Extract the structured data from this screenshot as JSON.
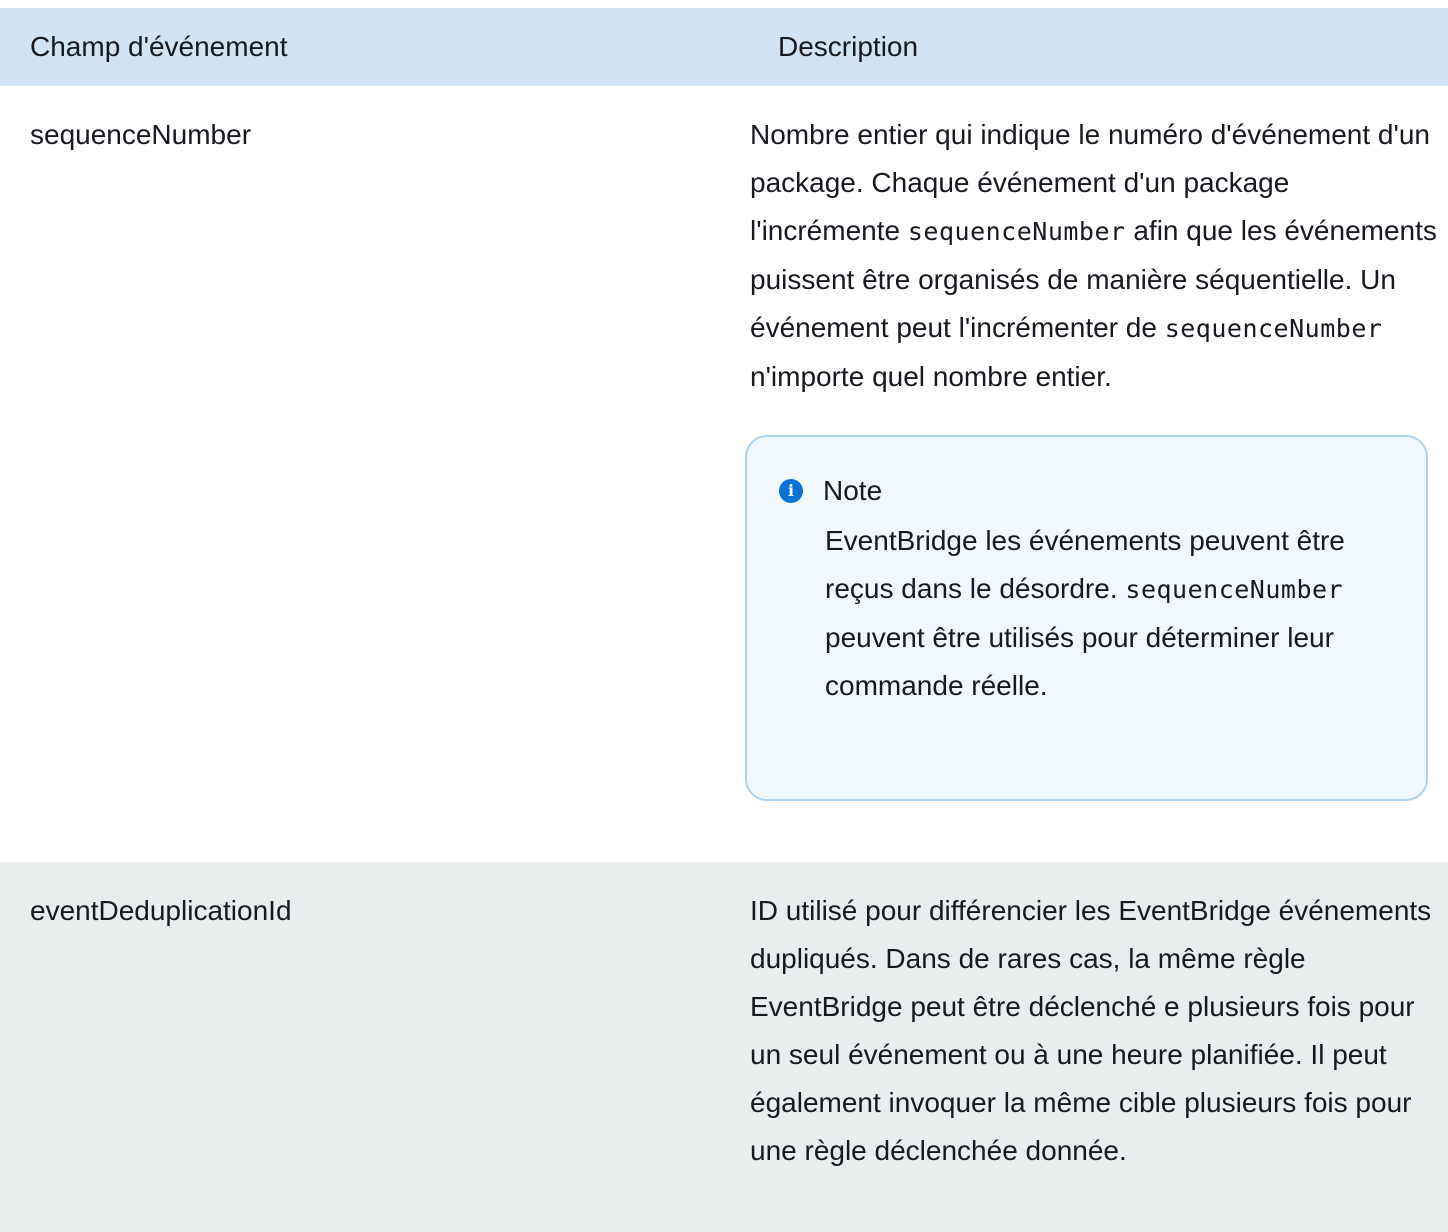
{
  "table": {
    "headers": [
      "Champ d'événement",
      "Description"
    ],
    "rows": [
      {
        "field": "sequenceNumber",
        "description_parts": [
          "Nombre entier qui indique le numéro d'événement d'un package. Chaque événement d'un package l'incrémente ",
          "sequenceNumber",
          " afin que les événements puissent être organisés de manière séquentielle. Un événement peut l'incrémenter de ",
          "sequenceNumber",
          " n'importe quel nombre entier."
        ],
        "note": {
          "title": "Note",
          "icon": "info-icon",
          "body_parts": [
            "EventBridge les événements peuvent être reçus dans le désordre. ",
            "sequenceNumber",
            " peuvent être utilisés pour déterminer leur commande réelle."
          ]
        }
      },
      {
        "field": "eventDeduplicationId",
        "description": "ID utilisé pour différencier les EventBridge événements dupliqués. Dans de rares cas, la même règle EventBridge peut être déclenché e plusieurs fois pour un seul événement ou à une heure planifiée. Il peut également invoquer la même cible plusieurs fois pour une règle déclenchée donnée."
      }
    ]
  },
  "colors": {
    "header_bg": "#d1e4f6",
    "alt_row_bg": "#eaeded",
    "note_bg": "#f1f8fd",
    "note_border": "#a9d3f1",
    "info_icon": "#0972d3"
  }
}
